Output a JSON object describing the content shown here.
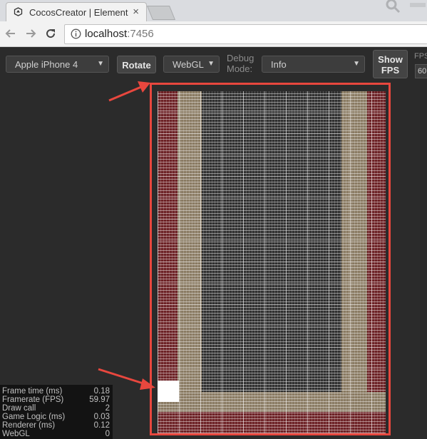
{
  "browser": {
    "tab_title": "CocosCreator | Element",
    "url_host": "localhost",
    "url_port": ":7456"
  },
  "preview_toolbar": {
    "device_select": "Apple iPhone 4",
    "rotate_label": "Rotate",
    "renderer_select": "WebGL",
    "debug_mode_label_line1": "Debug",
    "debug_mode_label_line2": "Mode:",
    "debug_mode_select": "Info",
    "show_fps_line1": "Show",
    "show_fps_line2": "FPS",
    "fps_label": "FPS",
    "fps_value": "60"
  },
  "stats": [
    {
      "label": "Frame time (ms)",
      "value": "0.18"
    },
    {
      "label": "Framerate (FPS)",
      "value": "59.97"
    },
    {
      "label": "Draw call",
      "value": "2"
    },
    {
      "label": "Game Logic (ms)",
      "value": "0.03"
    },
    {
      "label": "Renderer (ms)",
      "value": "0.12"
    },
    {
      "label": "WebGL",
      "value": "0"
    }
  ],
  "colors": {
    "annotation_red": "#e8473e",
    "canvas_red_band": "#6d2226",
    "canvas_tan_band": "#8a7b63"
  }
}
